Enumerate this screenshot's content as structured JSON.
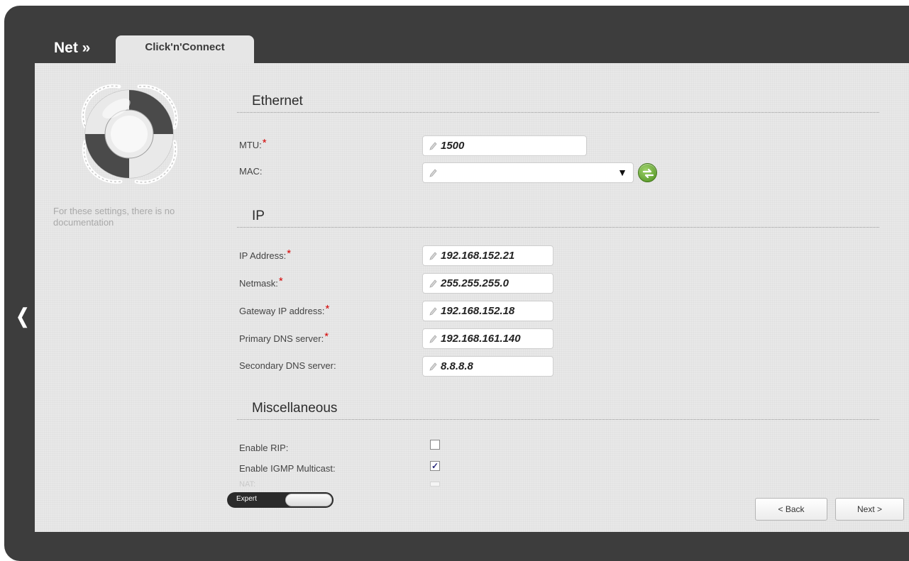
{
  "header": {
    "brand": "Net »",
    "active_tab": "Click'n'Connect"
  },
  "sidebar": {
    "icon": "lifebuoy-icon",
    "note": "For these settings, there is no documentation"
  },
  "sections": {
    "ethernet": {
      "title": "Ethernet",
      "mtu": {
        "label": "MTU:",
        "required": "*",
        "value": "1500"
      },
      "mac": {
        "label": "MAC:",
        "value": ""
      }
    },
    "ip": {
      "title": "IP",
      "ip_address": {
        "label": "IP Address:",
        "required": "*",
        "value": "192.168.152.21"
      },
      "netmask": {
        "label": "Netmask:",
        "required": "*",
        "value": "255.255.255.0"
      },
      "gateway": {
        "label": "Gateway IP address:",
        "required": "*",
        "value": "192.168.152.18"
      },
      "primary_dns": {
        "label": "Primary DNS server:",
        "required": "*",
        "value": "192.168.161.140"
      },
      "secondary_dns": {
        "label": "Secondary DNS server:",
        "value": "8.8.8.8"
      }
    },
    "misc": {
      "title": "Miscellaneous",
      "enable_rip": {
        "label": "Enable RIP:",
        "checked": false
      },
      "enable_igmp": {
        "label": "Enable IGMP Multicast:",
        "checked": true,
        "mark": "✓"
      },
      "nat": {
        "label": "NAT:"
      }
    }
  },
  "footer": {
    "expert_label": "Expert",
    "back_label": "< Back",
    "next_label": "Next >"
  },
  "colors": {
    "frame": "#3d3d3d",
    "panel": "#e8e8e8",
    "required": "#d40000",
    "refresh": "#5aa22a"
  }
}
